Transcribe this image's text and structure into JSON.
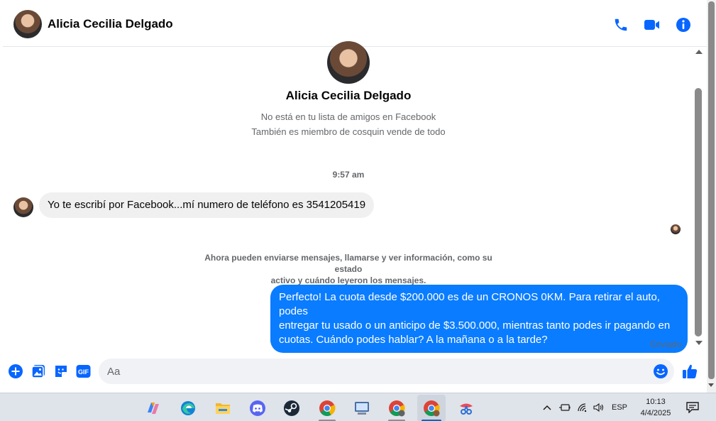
{
  "header": {
    "contact_name": "Alicia Cecilia Delgado"
  },
  "profile": {
    "name": "Alicia Cecilia Delgado",
    "line1": "No está en tu lista de amigos en Facebook",
    "line2": "También es miembro de cosquin vende de todo"
  },
  "chat": {
    "timestamp": "9:57 am",
    "incoming_message": "Yo te escribí por Facebook...mí numero de teléfono es 3541205419",
    "notice_line1": "Ahora pueden enviarse mensajes, llamarse y ver información, como su estado",
    "notice_line2": "activo y cuándo leyeron los mensajes.",
    "outgoing_message_line1": "Perfecto! La cuota desde $200.000 es de un CRONOS 0KM. Para retirar el auto, podes",
    "outgoing_message_line2": "entregar tu usado o un anticipo de $3.500.000, mientras tanto podes ir pagando en",
    "outgoing_message_line3": "cuotas. Cuándo podes hablar? A la mañana o a la tarde?",
    "status": "Enviado"
  },
  "composer": {
    "placeholder": "Aa",
    "gif_label": "GIF"
  },
  "taskbar": {
    "language": "ESP",
    "time": "10:13",
    "date": "4/4/2025"
  },
  "colors": {
    "accent": "#0a7cff",
    "icon_blue": "#0866ff",
    "incoming_bubble": "#f0f0f0",
    "muted_text": "#65676b"
  }
}
